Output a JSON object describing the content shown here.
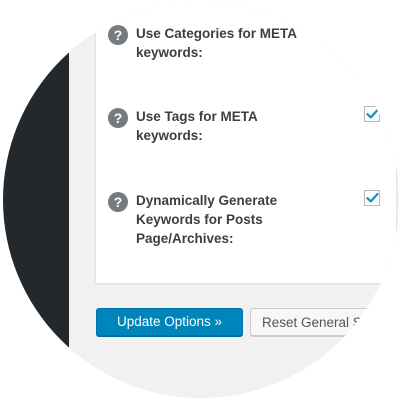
{
  "options": [
    {
      "label": "Use Categories for META keywords:",
      "has_checkbox": false,
      "checked": false
    },
    {
      "label": "Use Tags for META keywords:",
      "has_checkbox": true,
      "checked": true
    },
    {
      "label": "Dynamically Generate Keywords for Posts Page/Archives:",
      "has_checkbox": true,
      "checked": true
    }
  ],
  "help_icon_glyph": "?",
  "buttons": {
    "update_label": "Update Options »",
    "reset_label": "Reset General S"
  },
  "colors": {
    "admin_bar": "#23282d",
    "primary_button": "#0085ba",
    "checkmark": "#1e8cbe",
    "help_icon": "#777a7e"
  }
}
